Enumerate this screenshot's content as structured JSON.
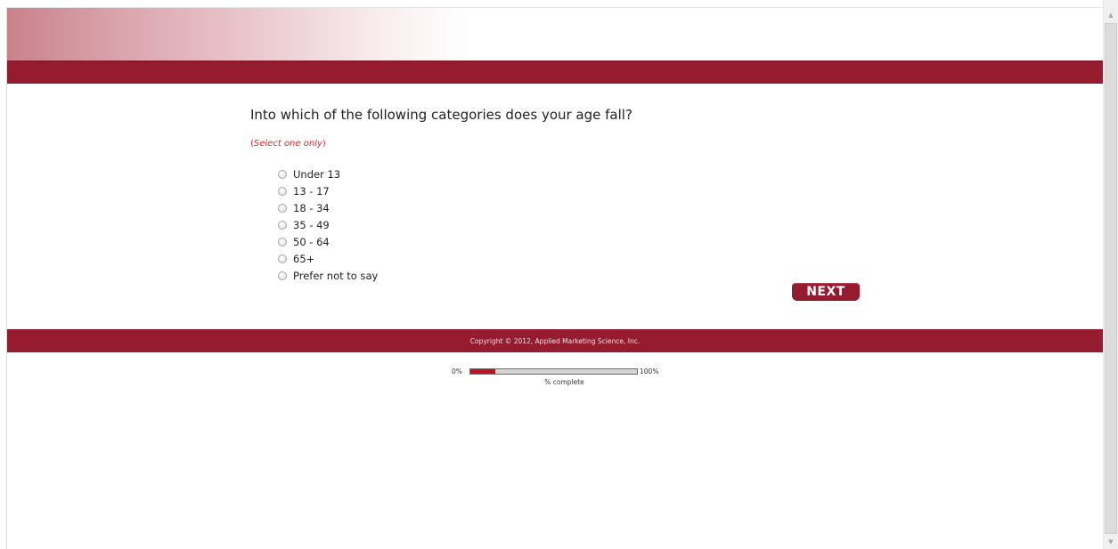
{
  "survey": {
    "question": "Into which of the following categories does your age fall?",
    "instruction_open": "(",
    "instruction": "Select one only",
    "instruction_close": ")",
    "options": [
      {
        "label": "Under 13",
        "selected": false
      },
      {
        "label": "13 - 17",
        "selected": false
      },
      {
        "label": "18 - 34",
        "selected": false
      },
      {
        "label": "35 - 49",
        "selected": false
      },
      {
        "label": "50 - 64",
        "selected": false
      },
      {
        "label": "65+",
        "selected": false
      },
      {
        "label": "Prefer not to say",
        "selected": false
      }
    ],
    "next_label": "NEXT"
  },
  "footer": {
    "copyright": "Copyright © 2012, Applied Marketing Science, Inc."
  },
  "progress": {
    "start_label": "0%",
    "end_label": "100%",
    "caption": "% complete",
    "percent": 15
  },
  "colors": {
    "brand": "#951b2e",
    "instruction": "#d42b2b",
    "progress_fill": "#c2121e"
  }
}
